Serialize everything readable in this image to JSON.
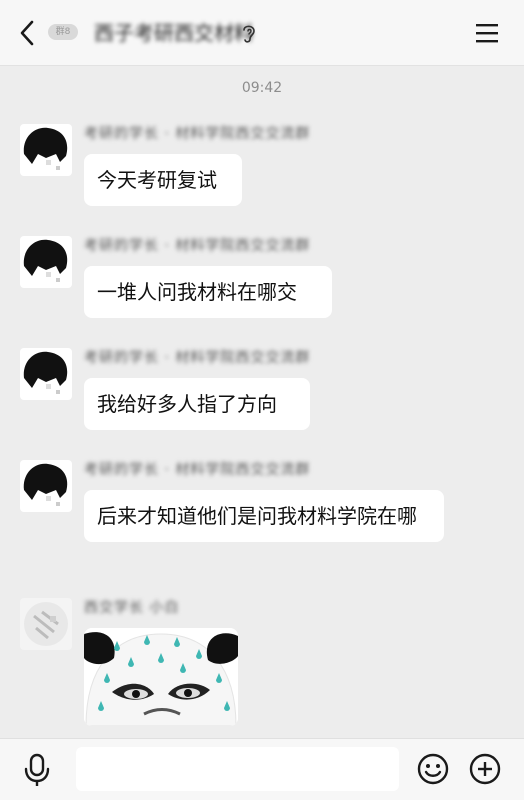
{
  "header": {
    "badge": "群8",
    "title": "西子考研西交材料",
    "back_icon": "chevron-left-icon",
    "ear_icon": "ear-icon",
    "menu_icon": "hamburger-menu-icon"
  },
  "chat": {
    "time": "09:42",
    "messages": [
      {
        "sender": "考研的学长 · 材料学院西交交流群",
        "text": "今天考研复试"
      },
      {
        "sender": "考研的学长 · 材料学院西交交流群",
        "text": "一堆人问我材料在哪交"
      },
      {
        "sender": "考研的学长 · 材料学院西交交流群",
        "text": "我给好多人指了方向"
      },
      {
        "sender": "考研的学长 · 材料学院西交交流群",
        "text": "后来才知道他们是问我材料学院在哪"
      }
    ],
    "sticker_message": {
      "sender": "西交学长 小白",
      "sticker": "sweating-panda-meme"
    }
  },
  "input_bar": {
    "value": "",
    "placeholder": "",
    "voice_icon": "microphone-icon",
    "emoji_icon": "smiley-icon",
    "more_icon": "plus-circle-icon"
  },
  "colors": {
    "background": "#ededed",
    "bubble": "#ffffff",
    "header": "#f7f7f7",
    "sticker_drops": "#3fb7b3"
  }
}
